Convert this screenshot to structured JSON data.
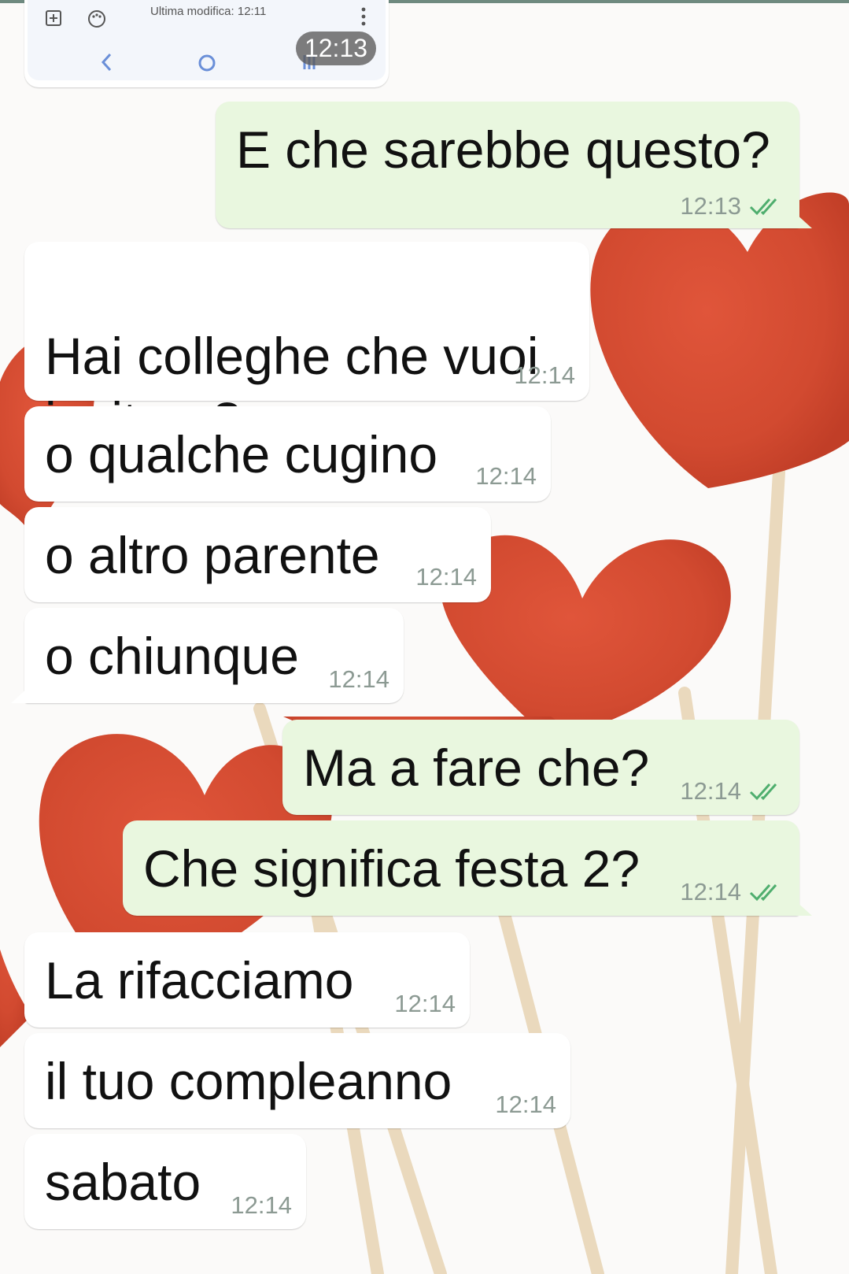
{
  "preview": {
    "last_modified": "Ultima modifica: 12:11",
    "media_time": "12:13"
  },
  "messages": [
    {
      "direction": "outgoing",
      "text": "E che sarebbe questo?",
      "time": "12:13",
      "read": true
    },
    {
      "direction": "incoming",
      "text": "Hai colleghe che vuoi\ninvitare?",
      "time": "12:14"
    },
    {
      "direction": "incoming",
      "text": "o qualche cugino",
      "time": "12:14"
    },
    {
      "direction": "incoming",
      "text": "o altro parente",
      "time": "12:14"
    },
    {
      "direction": "incoming",
      "text": "o chiunque",
      "time": "12:14"
    },
    {
      "direction": "outgoing",
      "text": "Ma a fare che?",
      "time": "12:14",
      "read": true
    },
    {
      "direction": "outgoing",
      "text": "Che significa festa 2?",
      "time": "12:14",
      "read": true
    },
    {
      "direction": "incoming",
      "text": "La rifacciamo",
      "time": "12:14"
    },
    {
      "direction": "incoming",
      "text": "il tuo compleanno",
      "time": "12:14"
    },
    {
      "direction": "incoming",
      "text": "sabato",
      "time": "12:14"
    }
  ],
  "colors": {
    "incoming_bubble": "#ffffff",
    "outgoing_bubble": "#e9f7df",
    "read_ticks": "#4fae6e",
    "timestamp": "#8c9a93",
    "wallpaper_hearts": "#d8472f",
    "wallpaper_sticks": "#e8d8bd"
  },
  "icons": {
    "preview_toolbar": [
      "add-box-icon",
      "palette-icon",
      "more-vert-icon"
    ],
    "preview_nav": [
      "back-chevron-icon",
      "home-circle-icon",
      "recents-bars-icon"
    ],
    "receipt": "double-check-icon"
  }
}
